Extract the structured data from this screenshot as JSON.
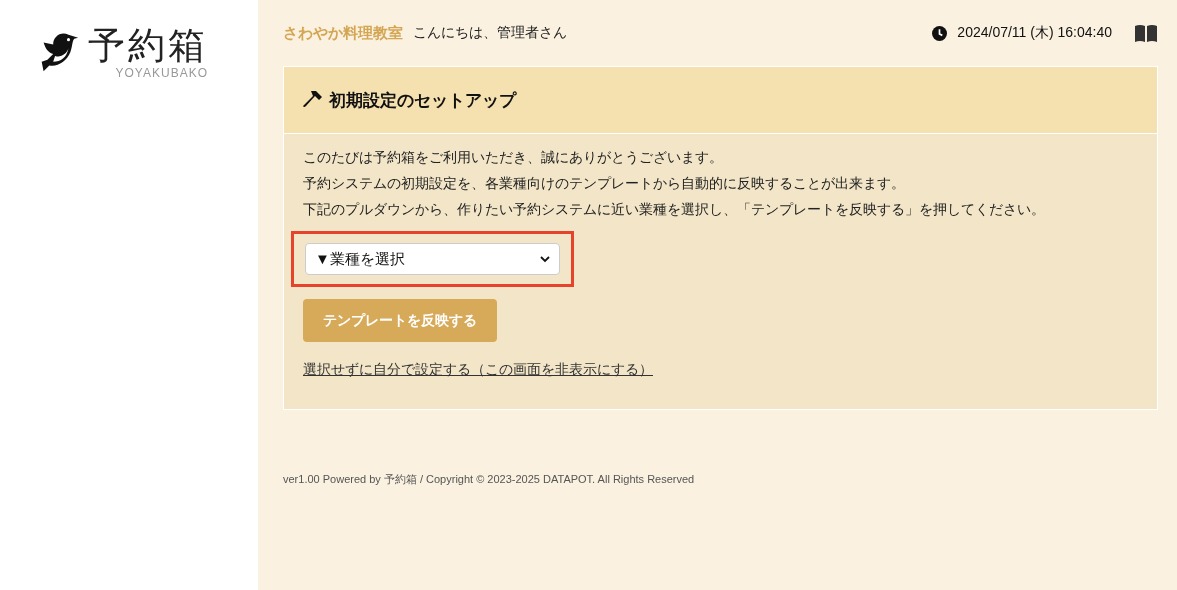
{
  "logo": {
    "title": "予約箱",
    "subtitle": "YOYAKUBAKO"
  },
  "header": {
    "shop_name": "さわやか料理教室",
    "greeting": "こんにちは、管理者さん",
    "datetime": "2024/07/11 (木) 16:04:40"
  },
  "panel": {
    "title": "初期設定のセットアップ",
    "paragraphs": [
      "このたびは予約箱をご利用いただき、誠にありがとうございます。",
      "予約システムの初期設定を、各業種向けのテンプレートから自動的に反映することが出来ます。",
      "下記のプルダウンから、作りたい予約システムに近い業種を選択し、「テンプレートを反映する」を押してください。"
    ],
    "dropdown": {
      "value": "▼業種を選択",
      "highlighted": true
    },
    "button": "テンプレートを反映する",
    "link": "選択せずに自分で設定する（この画面を非表示にする）"
  },
  "footer": "ver1.00 Powered by 予約箱 / Copyright © 2023-2025 DATAPOT. All Rights Reserved"
}
